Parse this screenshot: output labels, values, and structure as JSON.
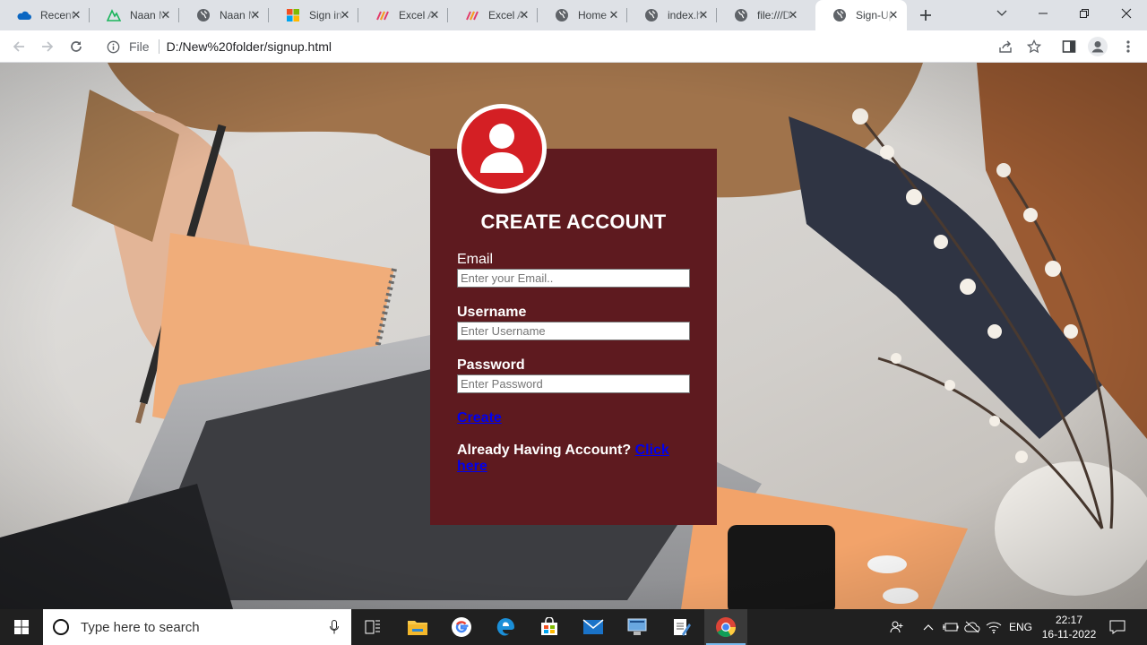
{
  "browser": {
    "tabs": [
      {
        "title": "Recent",
        "icon": "onedrive-icon"
      },
      {
        "title": "Naan Mudhalvan",
        "icon": "naan-mudhalvan-icon"
      },
      {
        "title": "Naan Mudhalvan",
        "icon": "globe-icon"
      },
      {
        "title": "Sign in",
        "icon": "microsoft-icon"
      },
      {
        "title": "Excel Add-ins",
        "icon": "excel-addin-icon"
      },
      {
        "title": "Excel Add-ins",
        "icon": "excel-addin-icon"
      },
      {
        "title": "Home",
        "icon": "globe-icon"
      },
      {
        "title": "index.html",
        "icon": "globe-icon"
      },
      {
        "title": "file:///D:/",
        "icon": "globe-icon"
      },
      {
        "title": "Sign-Up",
        "icon": "globe-icon",
        "active": true
      }
    ],
    "address": {
      "scheme_label": "File",
      "url": "D:/New%20folder/signup.html"
    }
  },
  "page": {
    "heading": "CREATE ACCOUNT",
    "email": {
      "label": "Email",
      "placeholder": "Enter your Email.."
    },
    "username": {
      "label": "Username",
      "placeholder": "Enter Username"
    },
    "password": {
      "label": "Password",
      "placeholder": "Enter Password"
    },
    "create_link": "Create",
    "already_text": "Already Having Account?",
    "click_here": "Click here",
    "colors": {
      "card": "#5e1a1f",
      "avatar": "#d41f24",
      "link": "#0000ee"
    }
  },
  "taskbar": {
    "search_placeholder": "Type here to search",
    "language": "ENG",
    "time": "22:17",
    "date": "16-11-2022"
  }
}
